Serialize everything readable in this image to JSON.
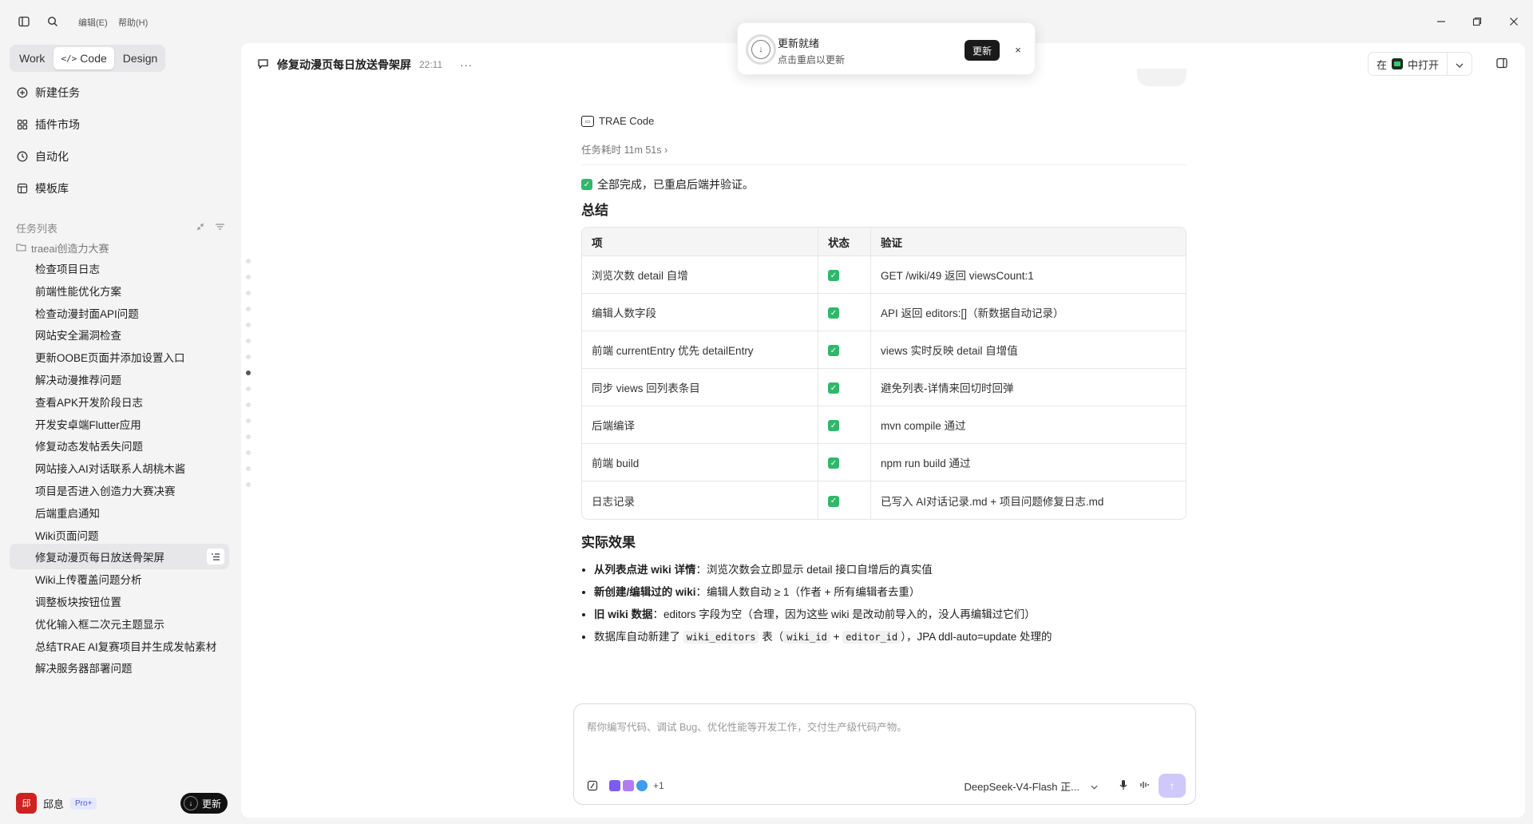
{
  "menu": {
    "edit": "编辑(E)",
    "help": "帮助(H)"
  },
  "modes": [
    "Work",
    "Code",
    "Design"
  ],
  "nav": {
    "new_task": "新建任务",
    "plugins": "插件市场",
    "automation": "自动化",
    "templates": "模板库"
  },
  "tasks_header": "任务列表",
  "folder": "traeai创造力大赛",
  "tasks": [
    "检查项目日志",
    "前端性能优化方案",
    "检查动漫封面API问题",
    "网站安全漏洞检查",
    "更新OOBE页面并添加设置入口",
    "解决动漫推荐问题",
    "查看APK开发阶段日志",
    "开发安卓端Flutter应用",
    "修复动态发帖丢失问题",
    "网站接入AI对话联系人胡桃木酱",
    "项目是否进入创造力大赛决赛",
    "后端重启通知",
    "Wiki页面问题",
    "修复动漫页每日放送骨架屏",
    "Wiki上传覆盖问题分析",
    "调整板块按钮位置",
    "优化输入框二次元主题显示",
    "总结TRAE AI复赛项目并生成发帖素材",
    "解决服务器部署问题"
  ],
  "user": {
    "name": "邱息",
    "badge": "Pro+",
    "update": "更新",
    "avatar": "邱"
  },
  "chat": {
    "title": "修复动漫页每日放送骨架屏",
    "time": "22:11",
    "more": "···",
    "open_prefix": "在",
    "open_label": "中打开",
    "agent": "TRAE Code",
    "duration": "任务耗时 11m 51s ›",
    "done": "全部完成，已重启后端并验证。",
    "summary_heading": "总结",
    "table": {
      "headers": [
        "项",
        "状态",
        "验证"
      ],
      "rows": [
        {
          "item": "浏览次数 detail 自增",
          "status": "✓",
          "verify": "GET /wiki/49 返回 viewsCount:1"
        },
        {
          "item": "编辑人数字段",
          "status": "✓",
          "verify": "API 返回 editors:[]（新数据自动记录）"
        },
        {
          "item": "前端 currentEntry 优先 detailEntry",
          "status": "✓",
          "verify": "views 实时反映 detail 自增值"
        },
        {
          "item": "同步 views 回列表条目",
          "status": "✓",
          "verify": "避免列表-详情来回切时回弹"
        },
        {
          "item": "后端编译",
          "status": "✓",
          "verify": "mvn compile 通过"
        },
        {
          "item": "前端 build",
          "status": "✓",
          "verify": "npm run build 通过"
        },
        {
          "item": "日志记录",
          "status": "✓",
          "verify": "已写入 AI对话记录.md + 项目问题修复日志.md"
        }
      ]
    },
    "effects_heading": "实际效果",
    "effects": [
      {
        "bold": "从列表点进 wiki 详情",
        "rest": "：浏览次数会立即显示 detail 接口自增后的真实值"
      },
      {
        "bold": "新创建/编辑过的 wiki",
        "rest": "：编辑人数自动 ≥ 1（作者 + 所有编辑者去重）"
      },
      {
        "bold": "旧 wiki 数据",
        "rest": "：editors 字段为空（合理，因为这些 wiki 是改动前导入的，没人再编辑过它们）"
      }
    ],
    "effect4": {
      "pre": "数据库自动新建了 ",
      "code1": "wiki_editors",
      "mid1": " 表（",
      "code2": "wiki_id",
      "mid2": " + ",
      "code3": "editor_id",
      "post": "），JPA ddl-auto=update 处理的"
    }
  },
  "composer": {
    "placeholder": "帮你编写代码、调试 Bug、优化性能等开发工作，交付生产级代码产物。",
    "extra_count": "+1",
    "model": "DeepSeek-V4-Flash 正..."
  },
  "toast": {
    "title": "更新就绪",
    "subtitle": "点击重启以更新",
    "button": "更新",
    "close": "×"
  },
  "colors": {
    "accent": "#2fb86a",
    "send": "#cfc8fb",
    "pro_badge": "#4c5bd4"
  }
}
